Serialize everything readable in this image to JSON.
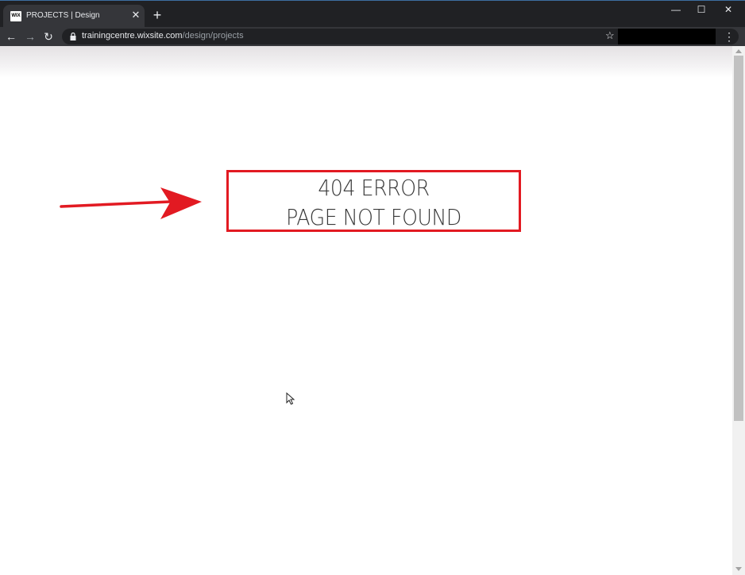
{
  "browser": {
    "tab": {
      "favicon_text": "WIX",
      "title": "PROJECTS | Design",
      "close_symbol": "✕"
    },
    "new_tab_symbol": "+",
    "window_controls": {
      "minimize": "—",
      "maximize": "☐",
      "close": "✕"
    },
    "nav": {
      "back": "←",
      "forward": "→",
      "reload": "↻"
    },
    "address_bar": {
      "domain": "trainingcentre.wixsite.com",
      "path": "/design/projects"
    },
    "bookmark_star": "☆",
    "menu_symbol": "⋮"
  },
  "page": {
    "error_title": "404 ERROR",
    "error_subtitle": "PAGE NOT FOUND"
  },
  "colors": {
    "annotation_red": "#e21a22",
    "tabstrip": "#202124",
    "toolbar": "#35363a",
    "error_text": "#3a3a3a"
  },
  "icons": {
    "lock": "lock-icon",
    "star": "star-icon",
    "annotation_arrow": "arrow-right-icon",
    "cursor": "mouse-cursor-icon"
  }
}
